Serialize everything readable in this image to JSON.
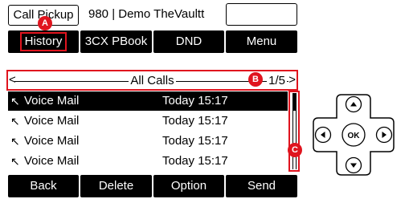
{
  "top_bar": {
    "call_pickup_label": "Call Pickup",
    "extension_info": "980 | Demo TheVaultt"
  },
  "top_softkeys": [
    "History",
    "3CX PBook",
    "DND",
    "Menu"
  ],
  "list": {
    "title": "All Calls",
    "page": "1/5",
    "rows": [
      {
        "name": "Voice Mail",
        "time": "Today 15:17",
        "selected": true
      },
      {
        "name": "Voice Mail",
        "time": "Today 15:17",
        "selected": false
      },
      {
        "name": "Voice Mail",
        "time": "Today 15:17",
        "selected": false
      },
      {
        "name": "Voice Mail",
        "time": "Today 15:17",
        "selected": false
      }
    ],
    "scroll_position": 0.2
  },
  "bottom_softkeys": [
    "Back",
    "Delete",
    "Option",
    "Send"
  ],
  "badges": {
    "a": "A",
    "b": "B",
    "c": "C"
  },
  "navpad": {
    "ok_label": "OK"
  },
  "icons": {
    "row_icon": "missed-call-arrow-icon",
    "nav_up": "arrow-up-icon",
    "nav_down": "arrow-down-icon",
    "nav_left": "arrow-left-icon",
    "nav_right": "arrow-right-icon"
  },
  "colors": {
    "highlight": "#e0141e",
    "softkey_bg": "#000000",
    "softkey_fg": "#ffffff"
  }
}
